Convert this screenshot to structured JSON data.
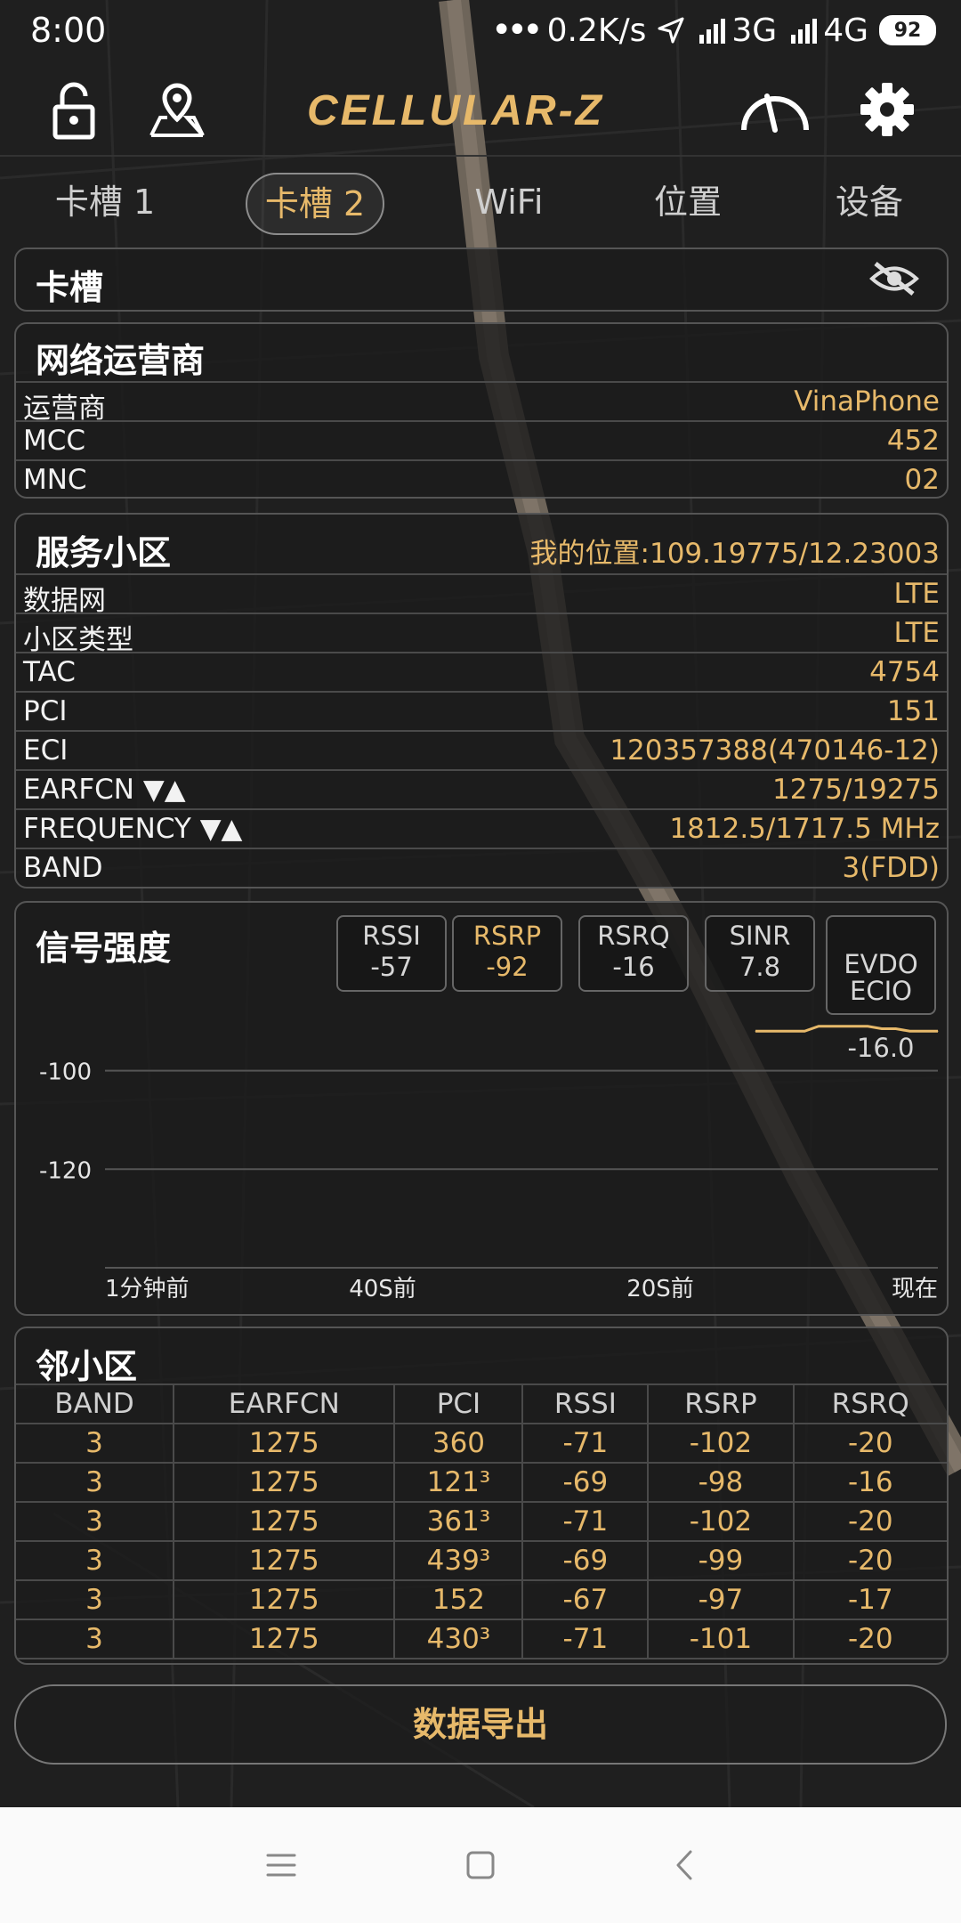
{
  "status_bar": {
    "time": "8:00",
    "speed": "0.2K/s",
    "net_3g": "3G",
    "net_4g": "4G",
    "battery": "92",
    "icons": [
      "dots-icon",
      "location-arrow-icon",
      "signal-icon",
      "battery-icon"
    ]
  },
  "toolbar": {
    "brand": "CELLULAR-Z",
    "icons": [
      "lock-icon",
      "map-pin-icon",
      "speedometer-icon",
      "gear-icon"
    ]
  },
  "tabs": [
    {
      "label": "卡槽 1",
      "active": false
    },
    {
      "label": "卡槽 2",
      "active": true
    },
    {
      "label": "WiFi",
      "active": false
    },
    {
      "label": "位置",
      "active": false
    },
    {
      "label": "设备",
      "active": false
    }
  ],
  "sim_card": {
    "title": "卡槽",
    "visibility_icon": "eye-off-icon"
  },
  "operator": {
    "title": "网络运营商",
    "rows": [
      {
        "label": "运营商",
        "value": "VinaPhone"
      },
      {
        "label": "MCC",
        "value": "452"
      },
      {
        "label": "MNC",
        "value": "02"
      }
    ]
  },
  "serving_cell": {
    "title": "服务小区",
    "location": "我的位置:109.19775/12.23003",
    "rows": [
      {
        "label": "数据网",
        "value": "LTE"
      },
      {
        "label": "小区类型",
        "value": "LTE"
      },
      {
        "label": "TAC",
        "value": "4754"
      },
      {
        "label": "PCI",
        "value": "151"
      },
      {
        "label": "ECI",
        "value": "120357388(470146-12)"
      },
      {
        "label": "EARFCN ▼▲",
        "value": "1275/19275"
      },
      {
        "label": "FREQUENCY ▼▲",
        "value": "1812.5/1717.5 MHz"
      },
      {
        "label": "BAND",
        "value": "3(FDD)"
      }
    ]
  },
  "signal": {
    "title": "信号强度",
    "metrics": [
      {
        "name": "RSSI",
        "value": "-57",
        "active": false
      },
      {
        "name": "RSRP",
        "value": "-92",
        "active": true
      },
      {
        "name": "RSRQ",
        "value": "-16",
        "active": false
      },
      {
        "name": "SINR",
        "value": "7.8",
        "active": false
      },
      {
        "name": "EVDO\nECIO",
        "value": "-16.0",
        "active": false
      }
    ],
    "colors": {
      "line": "#e7b96a",
      "grid": "#555555",
      "text": "#e6e6e6"
    }
  },
  "chart_data": {
    "type": "line",
    "title": "",
    "xlabel": "",
    "ylabel": "",
    "x_ticks": [
      "1分钟前",
      "40S前",
      "20S前",
      "现在"
    ],
    "y_ticks": [
      -100,
      -120
    ],
    "xlim": [
      -60,
      0
    ],
    "ylim": [
      -140,
      -84
    ],
    "grid": true,
    "series": [
      {
        "x": [
          -13,
          -11,
          -10,
          -9.5,
          -8.5,
          -7,
          -5,
          -4,
          -3,
          -2,
          -1,
          0
        ],
        "values": [
          -92,
          -92,
          -92,
          -92,
          -91,
          -91,
          -91,
          -91.5,
          -91.5,
          -92,
          -92,
          -92
        ]
      }
    ]
  },
  "neighbors": {
    "title": "邻小区",
    "columns": [
      "BAND",
      "EARFCN",
      "PCI",
      "RSSI",
      "RSRP",
      "RSRQ"
    ],
    "rows": [
      [
        "3",
        "1275",
        "360",
        "-71",
        "-102",
        "-20"
      ],
      [
        "3",
        "1275",
        "121³",
        "-69",
        "-98",
        "-16"
      ],
      [
        "3",
        "1275",
        "361³",
        "-71",
        "-102",
        "-20"
      ],
      [
        "3",
        "1275",
        "439³",
        "-69",
        "-99",
        "-20"
      ],
      [
        "3",
        "1275",
        "152",
        "-67",
        "-97",
        "-17"
      ],
      [
        "3",
        "1275",
        "430³",
        "-71",
        "-101",
        "-20"
      ]
    ]
  },
  "export": {
    "label": "数据导出"
  },
  "navbar": {
    "icons": [
      "menu-icon",
      "home-square-icon",
      "back-chevron-icon"
    ]
  },
  "theme": {
    "accent": "#e7b96a",
    "background": "#1e1e1e",
    "navbar": "#fafafa"
  }
}
